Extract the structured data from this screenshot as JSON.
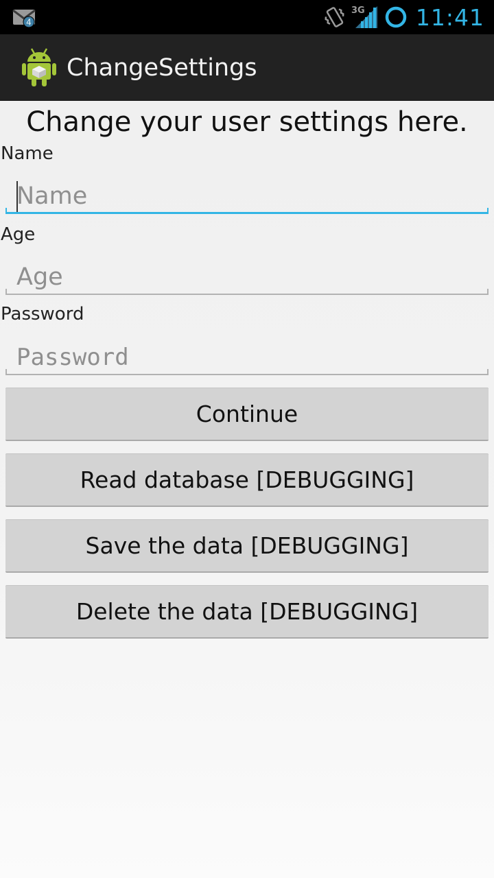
{
  "status_bar": {
    "time": "11:41",
    "notification_count": "4",
    "network_type": "3G",
    "icons": [
      "mail-icon",
      "vibrate-icon",
      "signal-icon",
      "sync-icon"
    ],
    "accent_color": "#33b5e5"
  },
  "action_bar": {
    "title": "ChangeSettings",
    "icon": "android-app-icon"
  },
  "form": {
    "heading": "Change your user settings here.",
    "name": {
      "label": "Name",
      "placeholder": "Name",
      "value": ""
    },
    "age": {
      "label": "Age",
      "placeholder": "Age",
      "value": ""
    },
    "password": {
      "label": "Password",
      "placeholder": "Password",
      "value": ""
    }
  },
  "buttons": {
    "continue": "Continue",
    "read_db": "Read database [DEBUGGING]",
    "save_data": "Save the data [DEBUGGING]",
    "delete_data": "Delete the data [DEBUGGING]"
  },
  "colors": {
    "focus_underline": "#33b5e5",
    "action_bar_bg": "#222222",
    "button_bg": "#d3d3d3"
  }
}
